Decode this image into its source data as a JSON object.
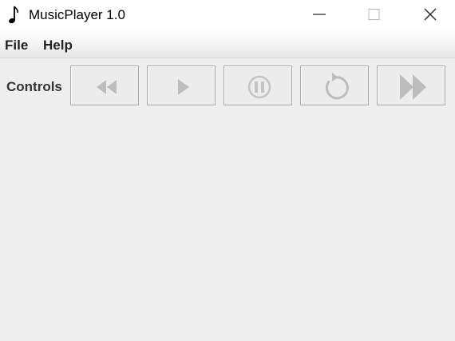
{
  "window": {
    "title": "MusicPlayer 1.0",
    "icon": "music-note-icon",
    "controls": [
      "minimize-icon",
      "maximize-icon",
      "close-icon"
    ]
  },
  "menu": {
    "file_label": "File",
    "help_label": "Help"
  },
  "controls": {
    "label": "Controls",
    "buttons": [
      {
        "name": "rewind-button",
        "icon": "rewind-icon"
      },
      {
        "name": "play-button",
        "icon": "play-icon"
      },
      {
        "name": "pause-button",
        "icon": "pause-icon"
      },
      {
        "name": "repeat-button",
        "icon": "repeat-icon"
      },
      {
        "name": "fast-forward-button",
        "icon": "fast-forward-icon"
      }
    ],
    "icon_color": "#bdbdbd"
  }
}
